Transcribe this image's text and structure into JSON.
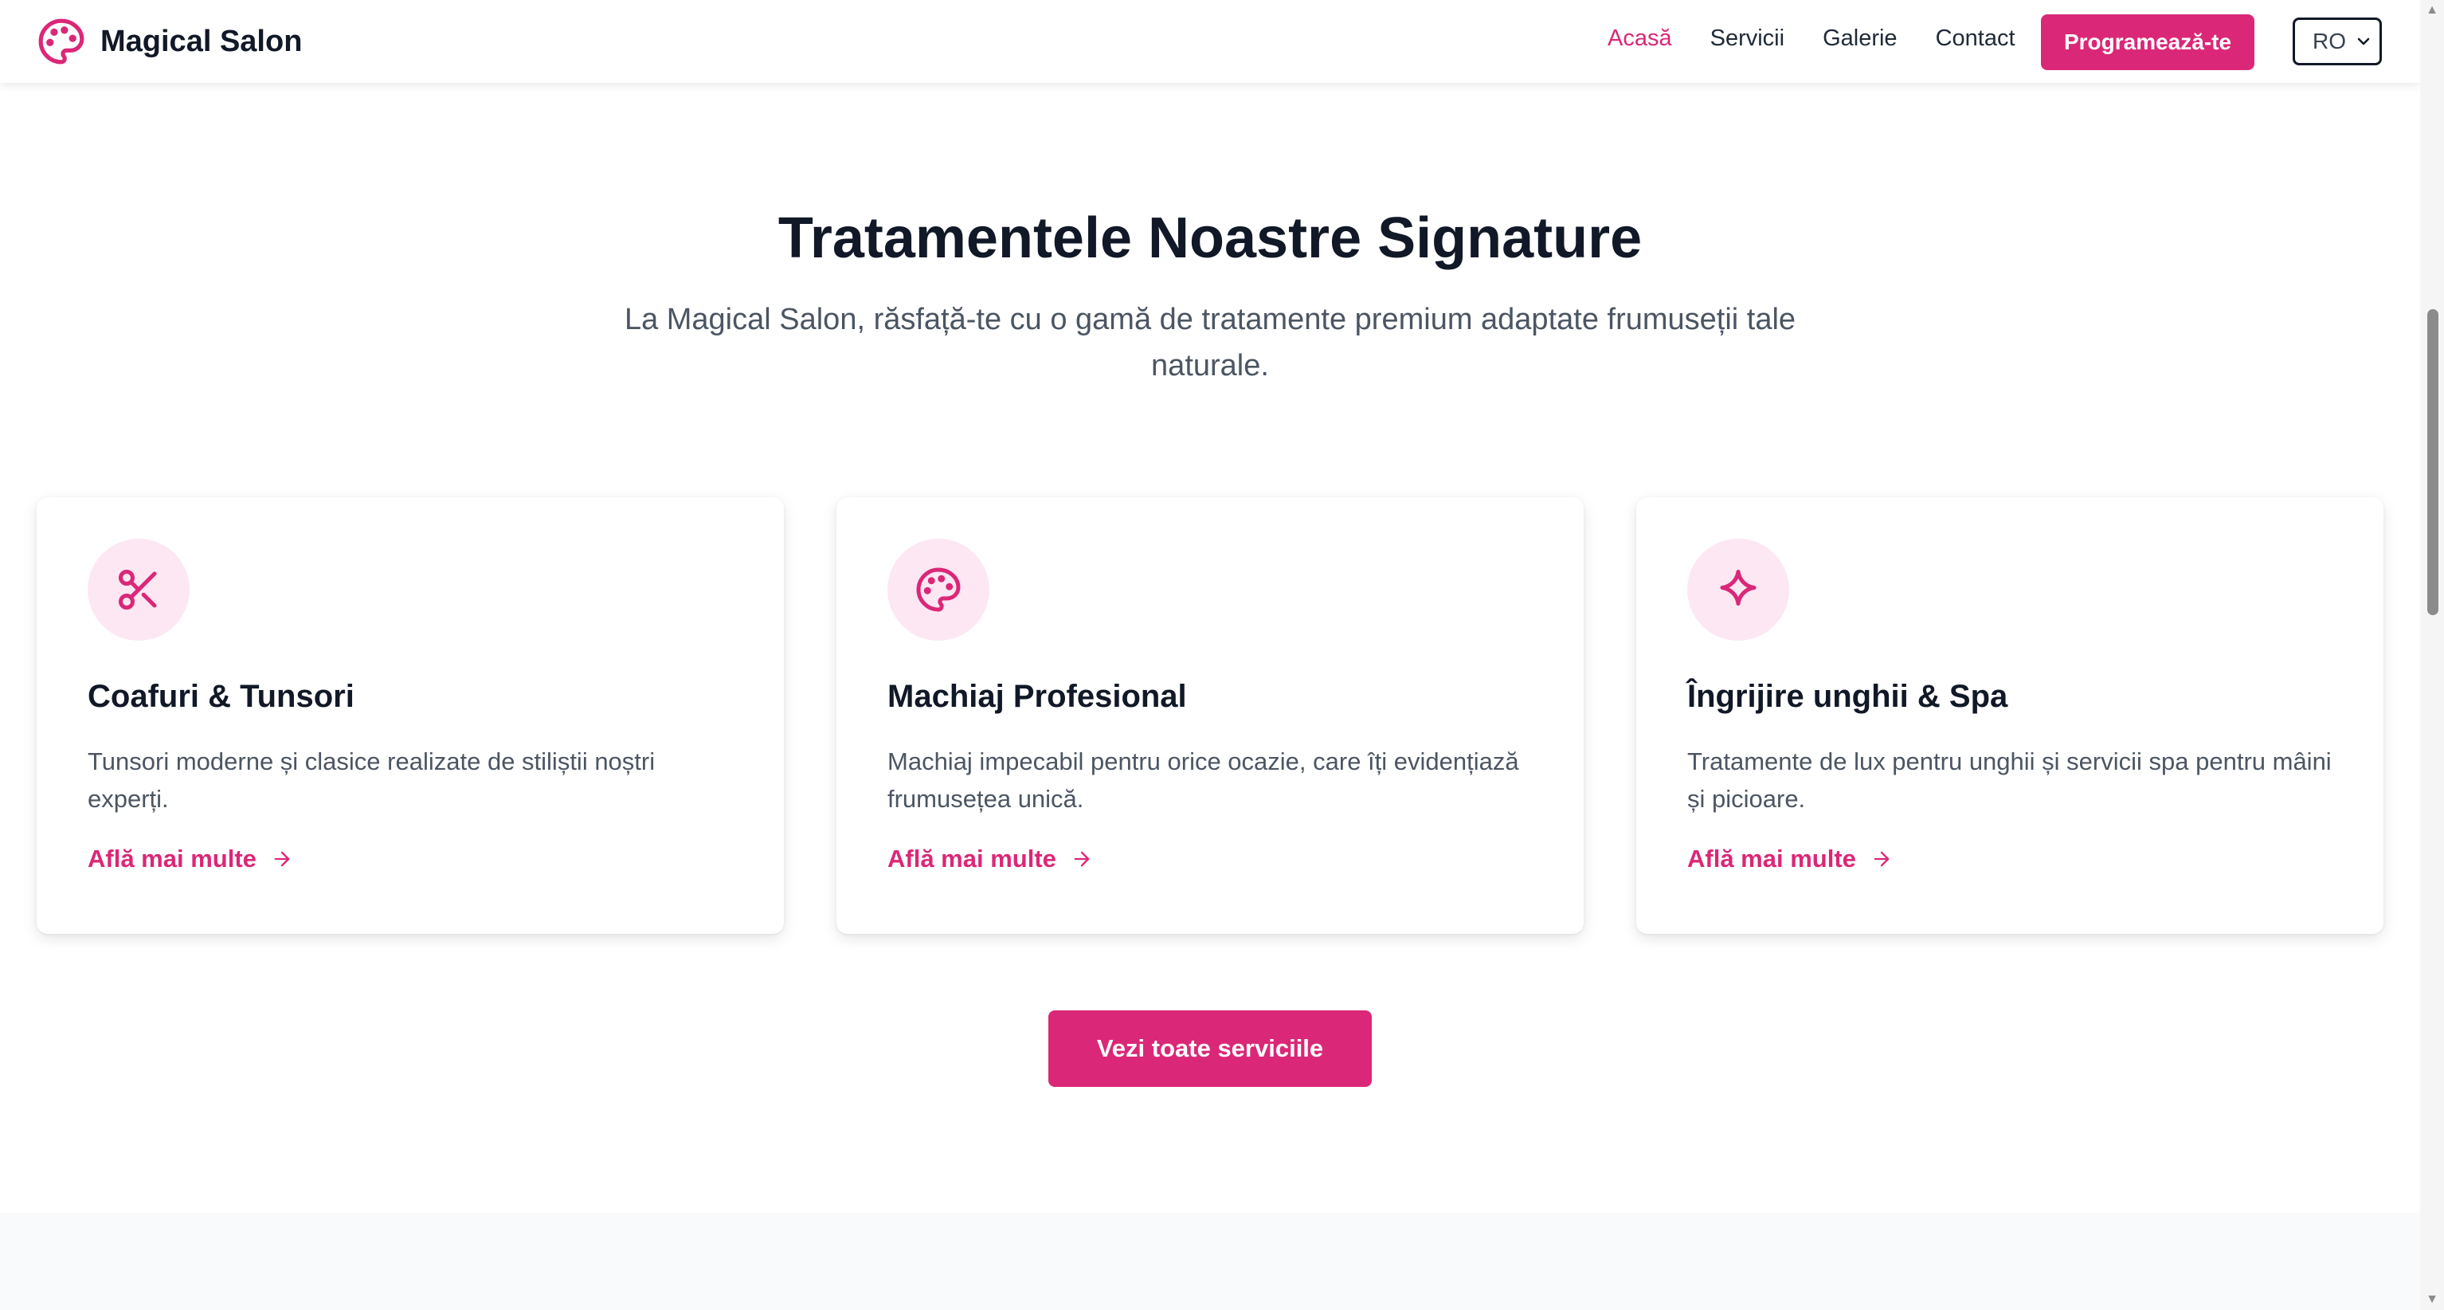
{
  "header": {
    "brand_name": "Magical Salon",
    "brand_icon": "palette-icon",
    "nav": [
      {
        "label": "Acasă",
        "active": true
      },
      {
        "label": "Servicii",
        "active": false
      },
      {
        "label": "Galerie",
        "active": false
      },
      {
        "label": "Contact",
        "active": false
      }
    ],
    "book_button": "Programează-te",
    "language": {
      "selected": "RO"
    }
  },
  "section": {
    "title": "Tratamentele Noastre Signature",
    "subtitle": "La Magical Salon, răsfață-te cu o gamă de tratamente premium adaptate frumuseții tale naturale."
  },
  "cards": [
    {
      "icon": "scissors-icon",
      "title": "Coafuri & Tunsori",
      "description": "Tunsori moderne și clasice realizate de stiliștii noștri experți.",
      "link": "Află mai multe"
    },
    {
      "icon": "palette-icon",
      "title": "Machiaj Profesional",
      "description": "Machiaj impecabil pentru orice ocazie, care îți evidențiază frumusețea unică.",
      "link": "Află mai multe"
    },
    {
      "icon": "sparkle-icon",
      "title": "Îngrijire unghii & Spa",
      "description": "Tratamente de lux pentru unghii și servicii spa pentru mâini și picioare.",
      "link": "Află mai multe"
    }
  ],
  "all_services_button": "Vezi toate serviciile",
  "colors": {
    "accent": "#db2777",
    "icon_bg": "#fce7f3",
    "heading": "#111827",
    "body_text": "#4b5563"
  }
}
